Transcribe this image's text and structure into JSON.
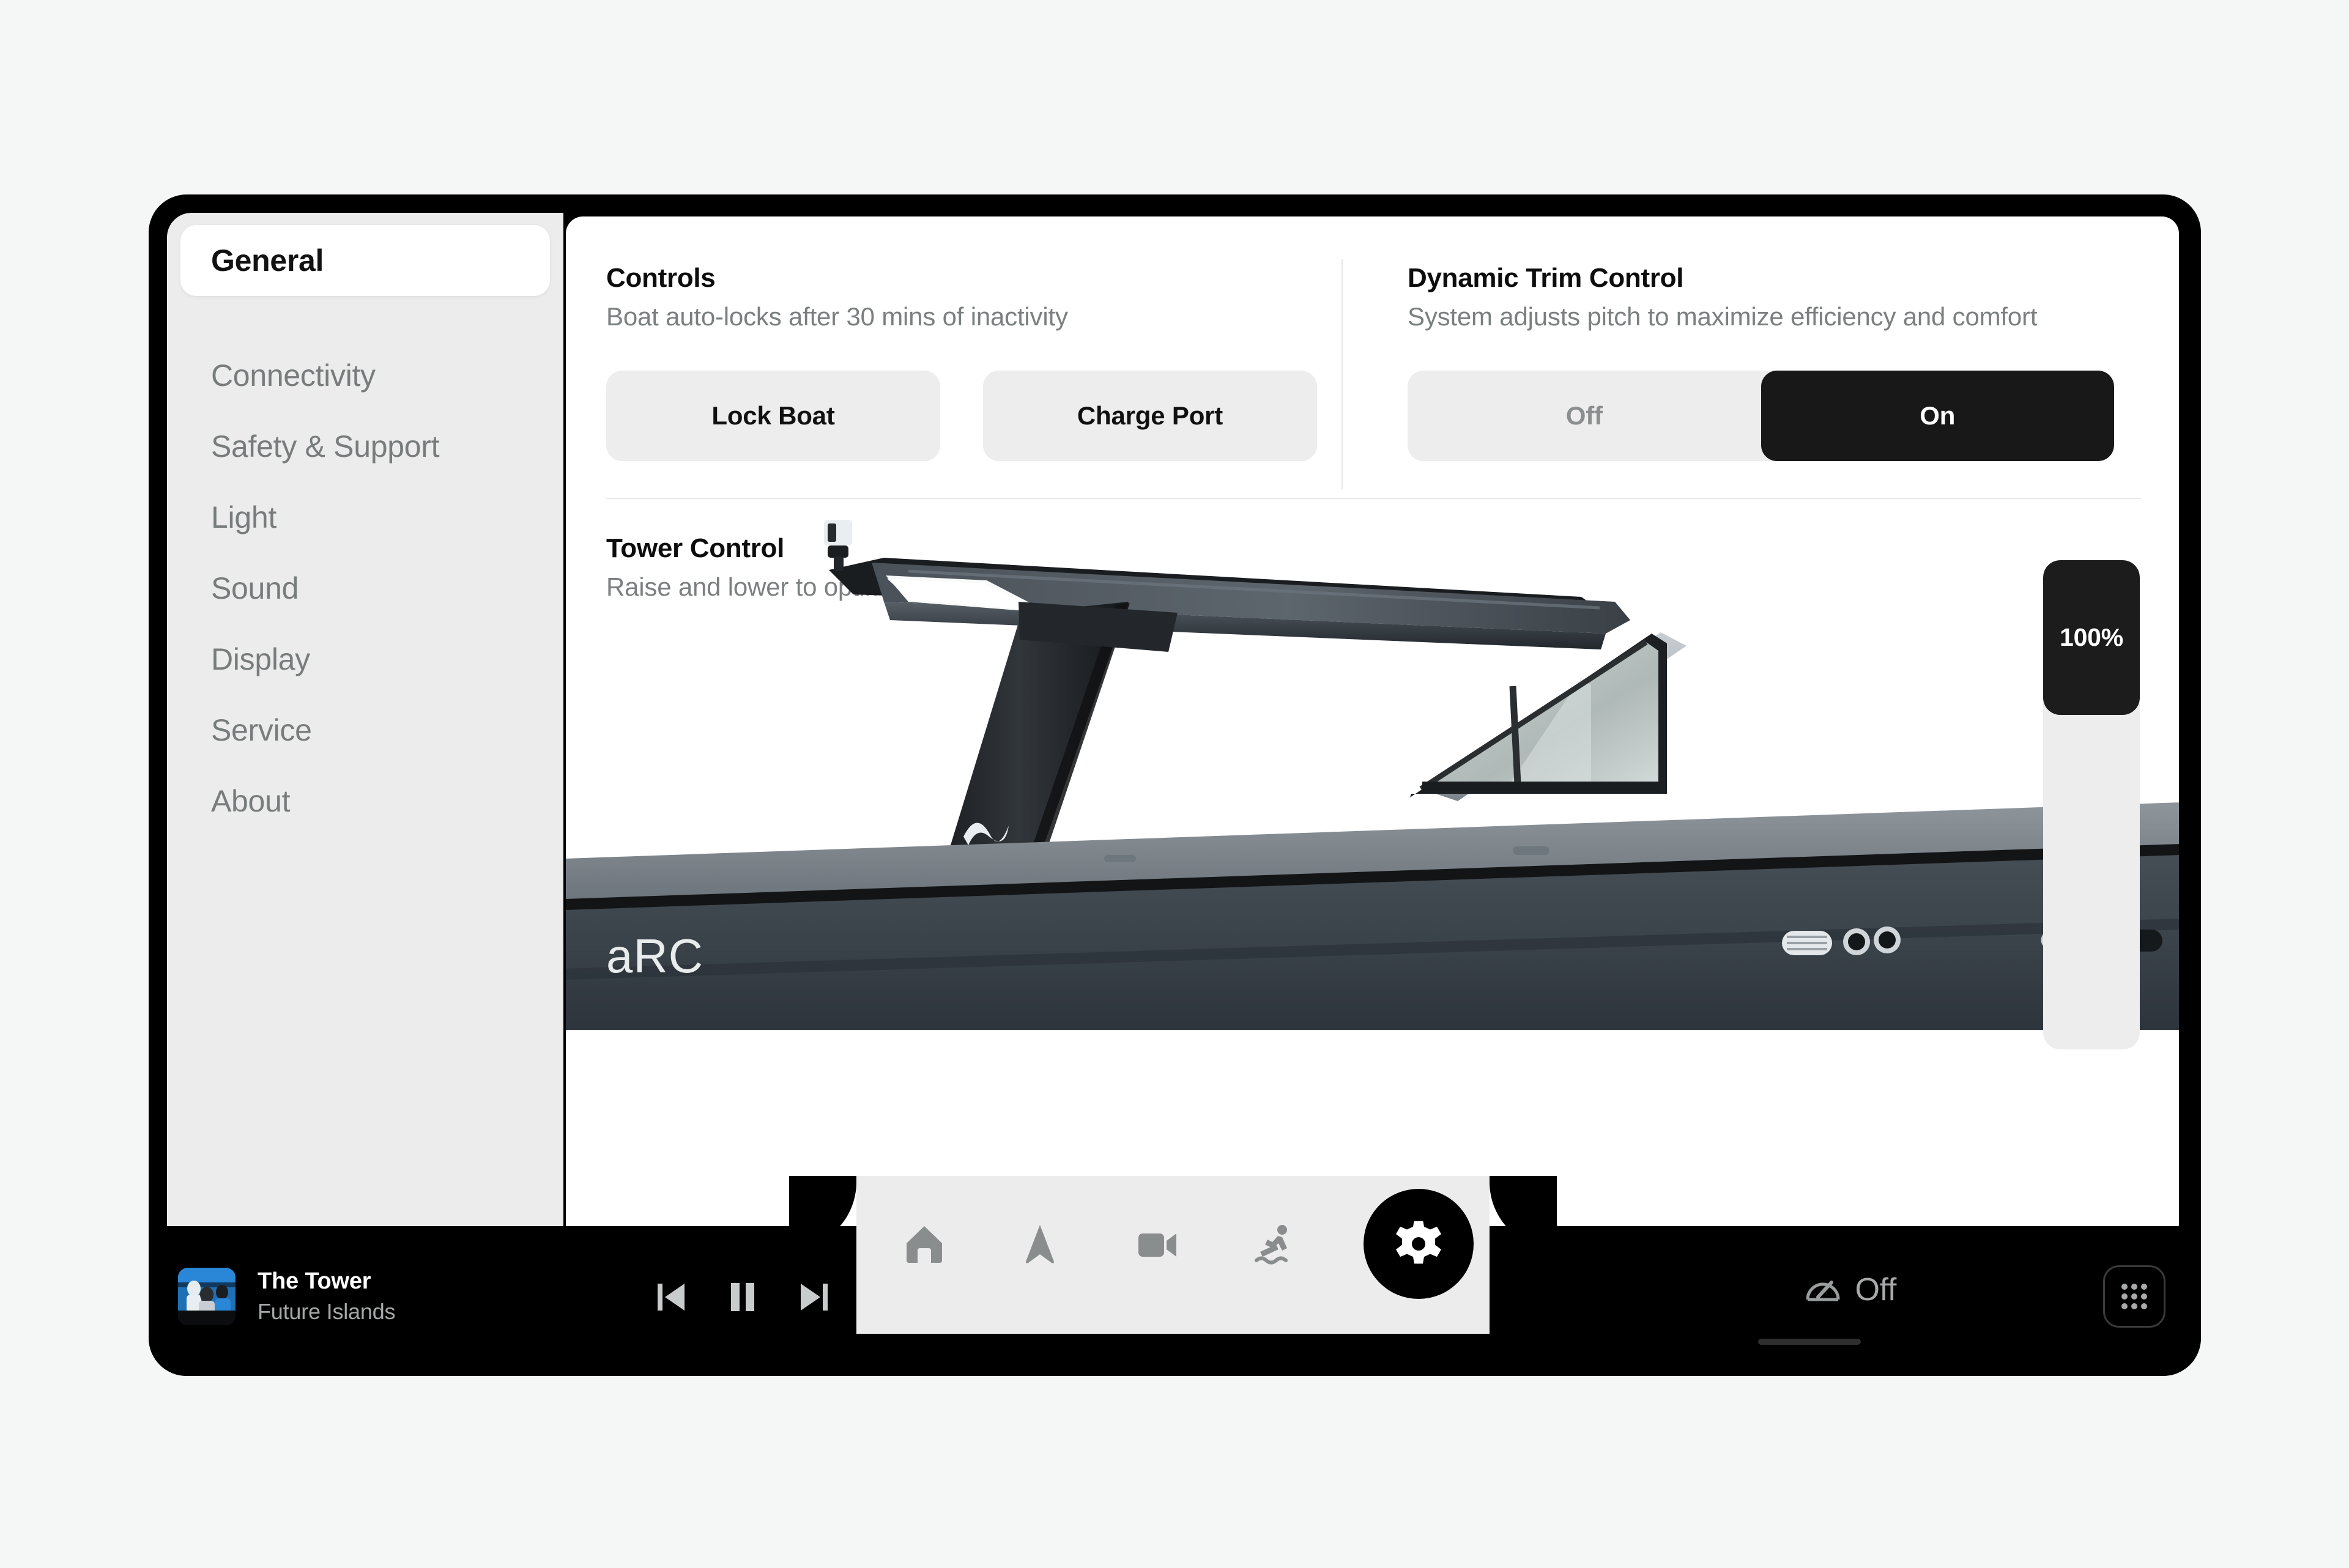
{
  "sidebar": {
    "items": [
      {
        "label": "General",
        "active": true
      },
      {
        "label": "Connectivity",
        "active": false
      },
      {
        "label": "Safety & Support",
        "active": false
      },
      {
        "label": "Light",
        "active": false
      },
      {
        "label": "Sound",
        "active": false
      },
      {
        "label": "Display",
        "active": false
      },
      {
        "label": "Service",
        "active": false
      },
      {
        "label": "About",
        "active": false
      }
    ]
  },
  "controls": {
    "title": "Controls",
    "subtitle": "Boat auto-locks after 30 mins of inactivity",
    "lock_boat_label": "Lock Boat",
    "charge_port_label": "Charge Port"
  },
  "trim": {
    "title": "Dynamic Trim Control",
    "subtitle": "System adjusts pitch to maximize efficiency and comfort",
    "off_label": "Off",
    "on_label": "On",
    "selected": "On"
  },
  "tower": {
    "title": "Tower Control",
    "subtitle": "Raise and lower to optimize position",
    "slider_value": "100%",
    "slider_percent": 100,
    "hull_logo": "arc"
  },
  "bottom_bar": {
    "now_playing": {
      "title": "The Tower",
      "artist": "Future Islands"
    },
    "transport": {
      "previous": "previous-track",
      "pause": "pause",
      "next": "next-track"
    },
    "nav": [
      {
        "icon": "home-icon",
        "active": false
      },
      {
        "icon": "navigate-icon",
        "active": false
      },
      {
        "icon": "camera-icon",
        "active": false
      },
      {
        "icon": "surf-icon",
        "active": false
      },
      {
        "icon": "gear-icon",
        "active": true
      }
    ],
    "cruise": {
      "icon": "speedometer-icon",
      "label": "Off"
    },
    "app_launcher": "grid-icon"
  },
  "colors": {
    "page_bg": "#f5f6f6",
    "bezel": "#000000",
    "sidebar_bg": "#ececec",
    "content_bg": "#ffffff",
    "button_bg": "#ededed",
    "accent_dark": "#181818",
    "text_primary": "#0d0d0d",
    "text_muted": "#7b7f7f"
  }
}
